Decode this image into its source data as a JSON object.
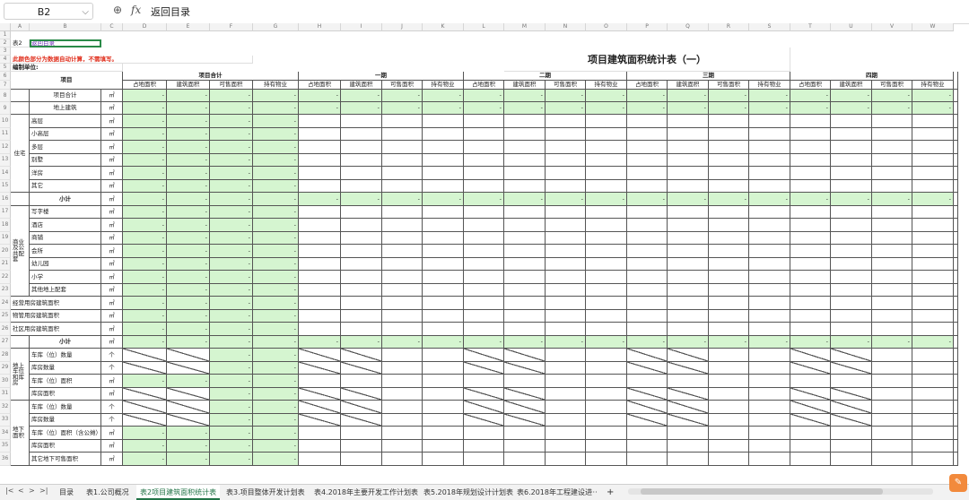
{
  "formula_bar": {
    "name_box": "B2",
    "zoom_icon": "magnifier-icon",
    "fx_label": "fx",
    "value": "返回目录"
  },
  "columns": [
    "A",
    "B",
    "C",
    "D",
    "E",
    "F",
    "G",
    "H",
    "I",
    "J",
    "K",
    "L",
    "M",
    "N",
    "O",
    "P",
    "Q",
    "R",
    "S",
    "T",
    "U",
    "V",
    "W"
  ],
  "row_numbers": [
    "1",
    "2",
    "3",
    "4",
    "5",
    "6",
    "7",
    "8",
    "9",
    "10",
    "11",
    "12",
    "13",
    "14",
    "15",
    "16",
    "17",
    "18",
    "19",
    "20",
    "21",
    "22",
    "23",
    "24",
    "25",
    "26",
    "27",
    "28",
    "29",
    "30",
    "31",
    "32",
    "33",
    "34",
    "35",
    "36"
  ],
  "sheet": {
    "table_id": "表2",
    "back_link": "返回目录",
    "note": "此颜色部分为数据自动计算，不需填写。",
    "title": "项目建筑面积统计表（一）",
    "unit_label": "编制单位:",
    "header_item": "项目",
    "groups": [
      "项目合计",
      "一期",
      "二期",
      "三期",
      "四期"
    ],
    "subheaders": [
      "占地面积",
      "建筑面积",
      "可售面积",
      "持有物业"
    ],
    "dash": "-",
    "unit_sqm": "㎡",
    "unit_count": "个",
    "rows": {
      "total": "项目合计",
      "above": "地上建筑",
      "res_cat": "住宅",
      "res_items": [
        "高层",
        "小高层",
        "多层",
        "别墅",
        "洋房",
        "其它"
      ],
      "subtotal": "小计",
      "biz_cat": "商业及公共配套",
      "biz_items": [
        "写字楼",
        "酒店",
        "商铺",
        "会所",
        "幼儿园",
        "小学",
        "其他地上配套"
      ],
      "biz_extra": [
        "经营用房建筑面积",
        "物管用房建筑面积",
        "社区用房建筑面积"
      ],
      "park_above_cat": "地上车位和库房",
      "park_above_items": [
        "车库（位）数量",
        "库房数量",
        "车库（位）面积",
        "库房面积"
      ],
      "under_cat": "地下面积",
      "under_items": [
        "车库（位）数量",
        "库房数量",
        "车库（位）面积（含公摊）",
        "库房面积",
        "其它地下可售面积"
      ]
    }
  },
  "tabs": {
    "nav": [
      "|<",
      "<",
      ">",
      ">|"
    ],
    "items": [
      "目录",
      "表1.公司概况",
      "表2项目建筑面积统计表",
      "表3.项目整体开发计划表",
      "表4.2018年主要开发工作计划表",
      "表5.2018年规划设计计划表",
      "表6.2018年工程建设进"
    ],
    "more": "···",
    "add": "+"
  }
}
